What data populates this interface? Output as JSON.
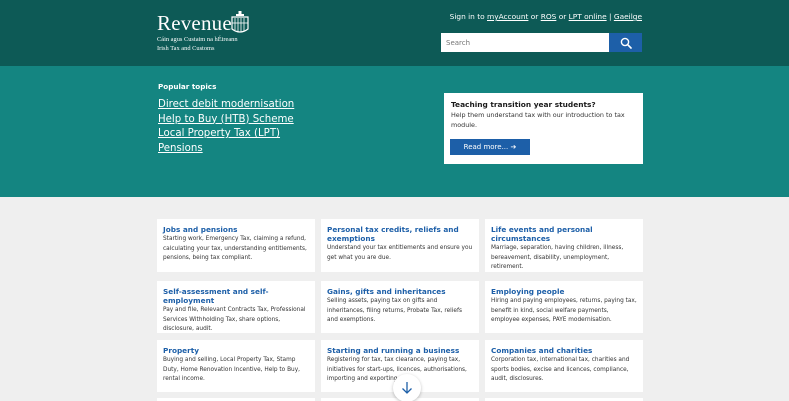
{
  "header": {
    "logo_word": "Revenue",
    "logo_sub1": "Cáin agus Custaim na hÉireann",
    "logo_sub2": "Irish Tax and Customs",
    "signin_prefix": "Sign in to",
    "link_myaccount": "myAccount",
    "or1": "or",
    "link_ros": "ROS",
    "or2": "or",
    "link_lpt": "LPT online",
    "separator": "|",
    "link_gaeilge": "Gaeilge",
    "search_placeholder": "Search"
  },
  "hero": {
    "popular_title": "Popular topics",
    "popular_links": [
      "Direct debit modernisation",
      "Help to Buy (HTB) Scheme",
      "Local Property Tax (LPT)",
      "Pensions"
    ],
    "promo_title": "Teaching transition year students?",
    "promo_text": "Help them understand tax with our introduction to tax module.",
    "promo_button": "Read more... ➔"
  },
  "cards": [
    {
      "title": "Jobs and pensions",
      "desc": "Starting work, Emergency Tax, claiming a refund, calculating your tax, understanding entitlements, pensions, being tax compliant."
    },
    {
      "title": "Personal tax credits, reliefs and exemptions",
      "desc": "Understand your tax entitlements and ensure you get what you are due."
    },
    {
      "title": "Life events and personal circumstances",
      "desc": "Marriage, separation, having children, illness, bereavement, disability, unemployment, retirement."
    },
    {
      "title": "Self-assessment and self-employment",
      "desc": "Pay and file, Relevant Contracts Tax, Professional Services Withholding Tax, share options, disclosure, audit."
    },
    {
      "title": "Gains, gifts and inheritances",
      "desc": "Selling assets, paying tax on gifts and inheritances, filing returns, Probate Tax, reliefs and exemptions."
    },
    {
      "title": "Employing people",
      "desc": "Hiring and paying employees, returns, paying tax, benefit in kind, social welfare payments, employee expenses, PAYE modernisation."
    },
    {
      "title": "Property",
      "desc": "Buying and selling, Local Property Tax, Stamp Duty, Home Renovation Incentive, Help to Buy, rental income."
    },
    {
      "title": "Starting and running a business",
      "desc": "Registering for tax, tax clearance, paying tax, initiatives for start-ups, licences, authorisations, importing and exporting."
    },
    {
      "title": "Companies and charities",
      "desc": "Corporation tax, international tax, charities and sports bodies, excise and licences, compliance, audit, disclosures."
    }
  ],
  "colors": {
    "header_bg": "#0d5a56",
    "hero_bg": "#148581",
    "accent_blue": "#1d5fa8",
    "page_bg": "#efefef"
  },
  "icons": {
    "search": "search-icon",
    "harp": "harp-icon",
    "scroll": "arrow-down-icon"
  }
}
